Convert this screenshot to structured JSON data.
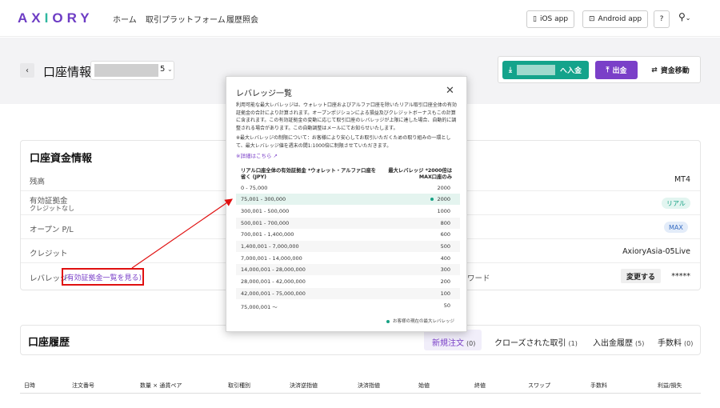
{
  "header": {
    "logo": {
      "part1": "AX",
      "part2": "I",
      "part3": "ORY"
    },
    "nav": [
      "ホーム",
      "取引プラットフォーム",
      "履歴照会"
    ],
    "ios_app": "iOS app",
    "android_app": "Android app",
    "help": "?"
  },
  "page": {
    "title": "口座情報",
    "account_tail": "5",
    "deposit_suffix": "へ入金",
    "withdraw": "出金",
    "transfer": "資金移動"
  },
  "funds": {
    "title": "口座資金情報",
    "balance_label": "残高",
    "margin_label": "有効証拠金",
    "margin_sub": "クレジットなし",
    "openpl_label": "オープン P/L",
    "credit_label": "クレジット",
    "leverage_label": "レバレッジ",
    "leverage_link": "(有効証拠金一覧を見る)",
    "platform": "MT4",
    "type_pill": "リアル",
    "leverage_pill": "MAX",
    "server": "AxioryAsia-05Live",
    "password_label": "ワード",
    "change_button": "変更する",
    "password_mask": "*****"
  },
  "modal": {
    "title": "レバレッジ一覧",
    "description": "利用可能な最大レバレッジは、ウォレット口座およびアルファ口座を除いたリアル取引口座全体の有効証拠金の合計により計算されます。オープンポジションによる損益及びクレジットボーナスもこの計算に含まれます。この有効証拠金の変動に応じて取引口座のレバレッジが上限に達した場合、自動的に調整される場合があります。この自動調整はメールにてお知らせいたします。",
    "note": "※最大レバレッジの制限について：お客様により安心してお取引いただくための取り組みの一環として、最大レバレッジ値を週末の間1:1000倍に制限させていただきます。",
    "link": "※詳細はこちら",
    "col_equity": "リアル口座全体の有効証拠金 *ウォレット・アルファ口座を省く (JPY)",
    "col_leverage": "最大レバレッジ *2000倍はMAX口座のみ",
    "rows": [
      {
        "range": "0 - 75,000",
        "leverage": "2000",
        "current": false
      },
      {
        "range": "75,001 - 300,000",
        "leverage": "2000",
        "current": true
      },
      {
        "range": "300,001 - 500,000",
        "leverage": "1000",
        "current": false
      },
      {
        "range": "500,001 - 700,000",
        "leverage": "800",
        "current": false
      },
      {
        "range": "700,001 - 1,400,000",
        "leverage": "600",
        "current": false
      },
      {
        "range": "1,400,001 - 7,000,000",
        "leverage": "500",
        "current": false
      },
      {
        "range": "7,000,001 - 14,000,000",
        "leverage": "400",
        "current": false
      },
      {
        "range": "14,000,001 - 28,000,000",
        "leverage": "300",
        "current": false
      },
      {
        "range": "28,000,001 - 42,000,000",
        "leverage": "200",
        "current": false
      },
      {
        "range": "42,000,001 - 75,000,000",
        "leverage": "100",
        "current": false
      },
      {
        "range": "75,000,001 〜",
        "leverage": "50",
        "current": false
      }
    ],
    "legend": "お客様の現在の最大レバレッジ"
  },
  "history": {
    "title": "口座履歴",
    "tabs": [
      {
        "label": "新規注文",
        "count": "(0)"
      },
      {
        "label": "クローズされた取引",
        "count": "(1)"
      },
      {
        "label": "入出金履歴",
        "count": "(5)"
      },
      {
        "label": "手数料",
        "count": "(0)"
      }
    ],
    "columns": [
      "日時",
      "注文番号",
      "数量 × 通貨ペア",
      "取引種別",
      "決済逆指値",
      "決済指値",
      "始値",
      "終値",
      "スワップ",
      "手数料",
      "利益/損失"
    ]
  },
  "colors": {
    "brand_purple": "#7a3fc8",
    "brand_green": "#14a38b",
    "annotation_red": "#e01010"
  }
}
